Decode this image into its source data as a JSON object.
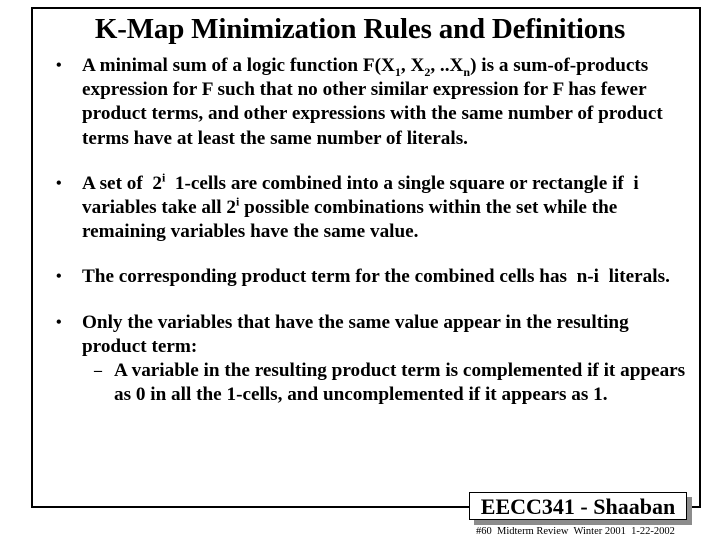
{
  "slide": {
    "title": "K-Map Minimization Rules and Definitions",
    "bullet_glyph": "•",
    "dash_glyph": "–",
    "bullets": [
      {
        "text_before": "A minimal sum of a logic function F(X",
        "sub1": "1",
        "text_mid1": ", X",
        "sub2": "2",
        "text_mid2": ", ..X",
        "sub3": "n",
        "text_after": ") is a sum-of-products expression for F such that no other similar expression for F has fewer product terms, and other expressions with the same number of product terms have at least the same number of literals."
      },
      {
        "text_before": "A set of  2",
        "sup1": "i",
        "text_mid": "  1-cells are combined into a single square or rectangle if  i  variables take all 2",
        "sup2": "i",
        "text_after": " possible combinations within the set while the remaining variables have the same value."
      },
      {
        "text": "The corresponding product term for the combined cells has  n-i  literals."
      },
      {
        "text": "Only the variables that have the same value appear in the resulting product term:",
        "sub_items": [
          "A variable in the resulting product term is complemented if it appears as 0 in all the 1-cells, and uncomplemented if it appears as 1."
        ]
      }
    ]
  },
  "badge": {
    "label": "EECC341 - Shaaban"
  },
  "footer": {
    "text": "#60  Midterm Review  Winter 2001  1-22-2002"
  }
}
